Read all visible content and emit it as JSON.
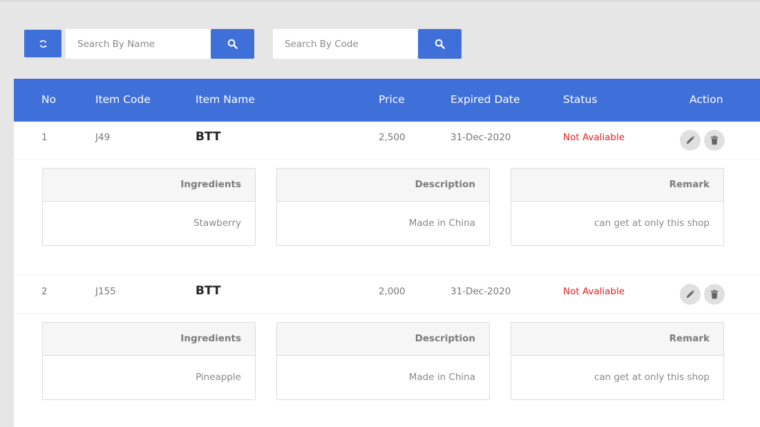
{
  "toolbar": {
    "refresh_icon": "refresh-icon",
    "name_search": {
      "placeholder": "Search By Name",
      "value": ""
    },
    "code_search": {
      "placeholder": "Search By Code",
      "value": ""
    },
    "search_icon": "search-icon"
  },
  "table": {
    "headers": {
      "no": "No",
      "code": "Item Code",
      "name": "Item Name",
      "price": "Price",
      "expired": "Expired Date",
      "status": "Status",
      "action": "Action"
    },
    "rows": [
      {
        "no": "1",
        "code": "J49",
        "name": "BTT",
        "price": "2,500",
        "expired": "31-Dec-2020",
        "status": "Not Avaliable",
        "details": {
          "ingredients_label": "Ingredients",
          "ingredients": "Stawberry",
          "description_label": "Description",
          "description": "Made in China",
          "remark_label": "Remark",
          "remark": "can get at only this shop"
        }
      },
      {
        "no": "2",
        "code": "J155",
        "name": "BTT",
        "price": "2,000",
        "expired": "31-Dec-2020",
        "status": "Not Avaliable",
        "details": {
          "ingredients_label": "Ingredients",
          "ingredients": "Pineapple",
          "description_label": "Description",
          "description": "Made in China",
          "remark_label": "Remark",
          "remark": "can get at only this shop"
        }
      }
    ]
  },
  "colors": {
    "primary": "#3f6fd9",
    "status_unavailable": "#e82020",
    "background": "#e6e6e6"
  }
}
